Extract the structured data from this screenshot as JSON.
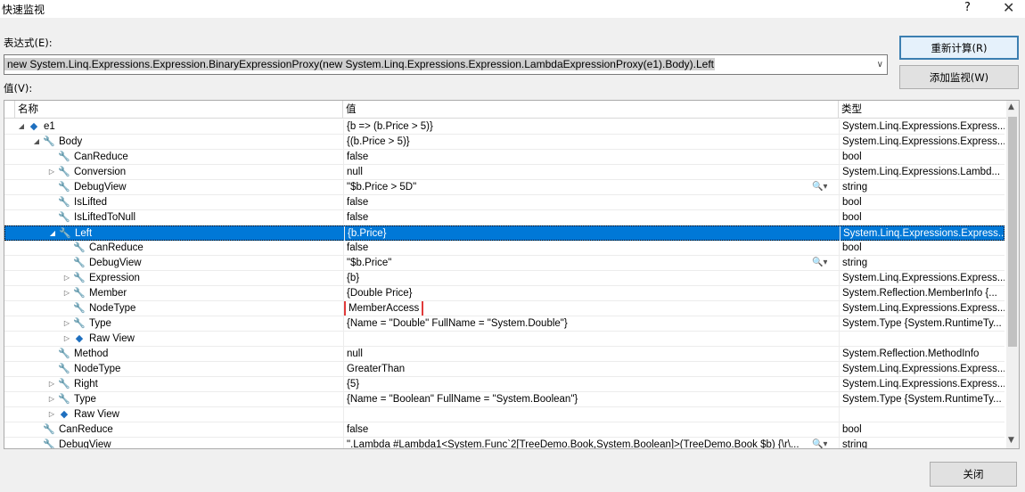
{
  "window": {
    "title": "快速监视",
    "help": "?",
    "close": "✕"
  },
  "expression": {
    "label": "表达式(E):",
    "value": "new System.Linq.Expressions.Expression.BinaryExpressionProxy(new System.Linq.Expressions.Expression.LambdaExpressionProxy(e1).Body).Left",
    "dropdown": "∨"
  },
  "buttons": {
    "recalc": "重新计算(R)",
    "add_watch": "添加监视(W)",
    "close": "关闭"
  },
  "value_label": "值(V):",
  "columns": {
    "name": "名称",
    "value": "值",
    "type": "类型"
  },
  "rows": [
    {
      "level": 0,
      "exp": "◢",
      "icon": "cube",
      "name": "e1",
      "value": "{b => (b.Price > 5)}",
      "type": "System.Linq.Expressions.Express..."
    },
    {
      "level": 1,
      "exp": "◢",
      "icon": "wrench",
      "name": "Body",
      "value": "{(b.Price > 5)}",
      "type": "System.Linq.Expressions.Express..."
    },
    {
      "level": 2,
      "exp": "",
      "icon": "wrench",
      "name": "CanReduce",
      "value": "false",
      "type": "bool"
    },
    {
      "level": 2,
      "exp": "▷",
      "icon": "wrench",
      "name": "Conversion",
      "value": "null",
      "type": "System.Linq.Expressions.Lambd..."
    },
    {
      "level": 2,
      "exp": "",
      "icon": "wrench",
      "name": "DebugView",
      "value": "\"$b.Price > 5D\"",
      "type": "string",
      "mag": "🔍▾"
    },
    {
      "level": 2,
      "exp": "",
      "icon": "wrench",
      "name": "IsLifted",
      "value": "false",
      "type": "bool"
    },
    {
      "level": 2,
      "exp": "",
      "icon": "wrench",
      "name": "IsLiftedToNull",
      "value": "false",
      "type": "bool"
    },
    {
      "level": 2,
      "exp": "◢",
      "icon": "wrench",
      "name": "Left",
      "value": "{b.Price}",
      "type": "System.Linq.Expressions.Express...",
      "selected": true
    },
    {
      "level": 3,
      "exp": "",
      "icon": "wrench",
      "name": "CanReduce",
      "value": "false",
      "type": "bool"
    },
    {
      "level": 3,
      "exp": "",
      "icon": "wrench",
      "name": "DebugView",
      "value": "\"$b.Price\"",
      "type": "string",
      "mag": "🔍▾"
    },
    {
      "level": 3,
      "exp": "▷",
      "icon": "wrench",
      "name": "Expression",
      "value": "{b}",
      "type": "System.Linq.Expressions.Express..."
    },
    {
      "level": 3,
      "exp": "▷",
      "icon": "wrench",
      "name": "Member",
      "value": "{Double Price}",
      "type": "System.Reflection.MemberInfo {..."
    },
    {
      "level": 3,
      "exp": "",
      "icon": "wrench",
      "name": "NodeType",
      "value": "MemberAccess",
      "type": "System.Linq.Expressions.Express...",
      "highlight": true
    },
    {
      "level": 3,
      "exp": "▷",
      "icon": "wrench",
      "name": "Type",
      "value": "{Name = \"Double\" FullName = \"System.Double\"}",
      "type": "System.Type {System.RuntimeTy..."
    },
    {
      "level": 3,
      "exp": "▷",
      "icon": "cube",
      "name": "Raw View",
      "value": "",
      "type": ""
    },
    {
      "level": 2,
      "exp": "",
      "icon": "wrench",
      "name": "Method",
      "value": "null",
      "type": "System.Reflection.MethodInfo"
    },
    {
      "level": 2,
      "exp": "",
      "icon": "wrench",
      "name": "NodeType",
      "value": "GreaterThan",
      "type": "System.Linq.Expressions.Express..."
    },
    {
      "level": 2,
      "exp": "▷",
      "icon": "wrench",
      "name": "Right",
      "value": "{5}",
      "type": "System.Linq.Expressions.Express..."
    },
    {
      "level": 2,
      "exp": "▷",
      "icon": "wrench",
      "name": "Type",
      "value": "{Name = \"Boolean\" FullName = \"System.Boolean\"}",
      "type": "System.Type {System.RuntimeTy..."
    },
    {
      "level": 2,
      "exp": "▷",
      "icon": "cube",
      "name": "Raw View",
      "value": "",
      "type": ""
    },
    {
      "level": 1,
      "exp": "",
      "icon": "wrench",
      "name": "CanReduce",
      "value": "false",
      "type": "bool"
    },
    {
      "level": 1,
      "exp": "",
      "icon": "wrench",
      "name": "DebugView",
      "value": "\".Lambda #Lambda1<System.Func`2[TreeDemo.Book,System.Boolean]>(TreeDemo.Book $b) {\\r\\...",
      "type": "string",
      "mag": "🔍▾"
    }
  ]
}
